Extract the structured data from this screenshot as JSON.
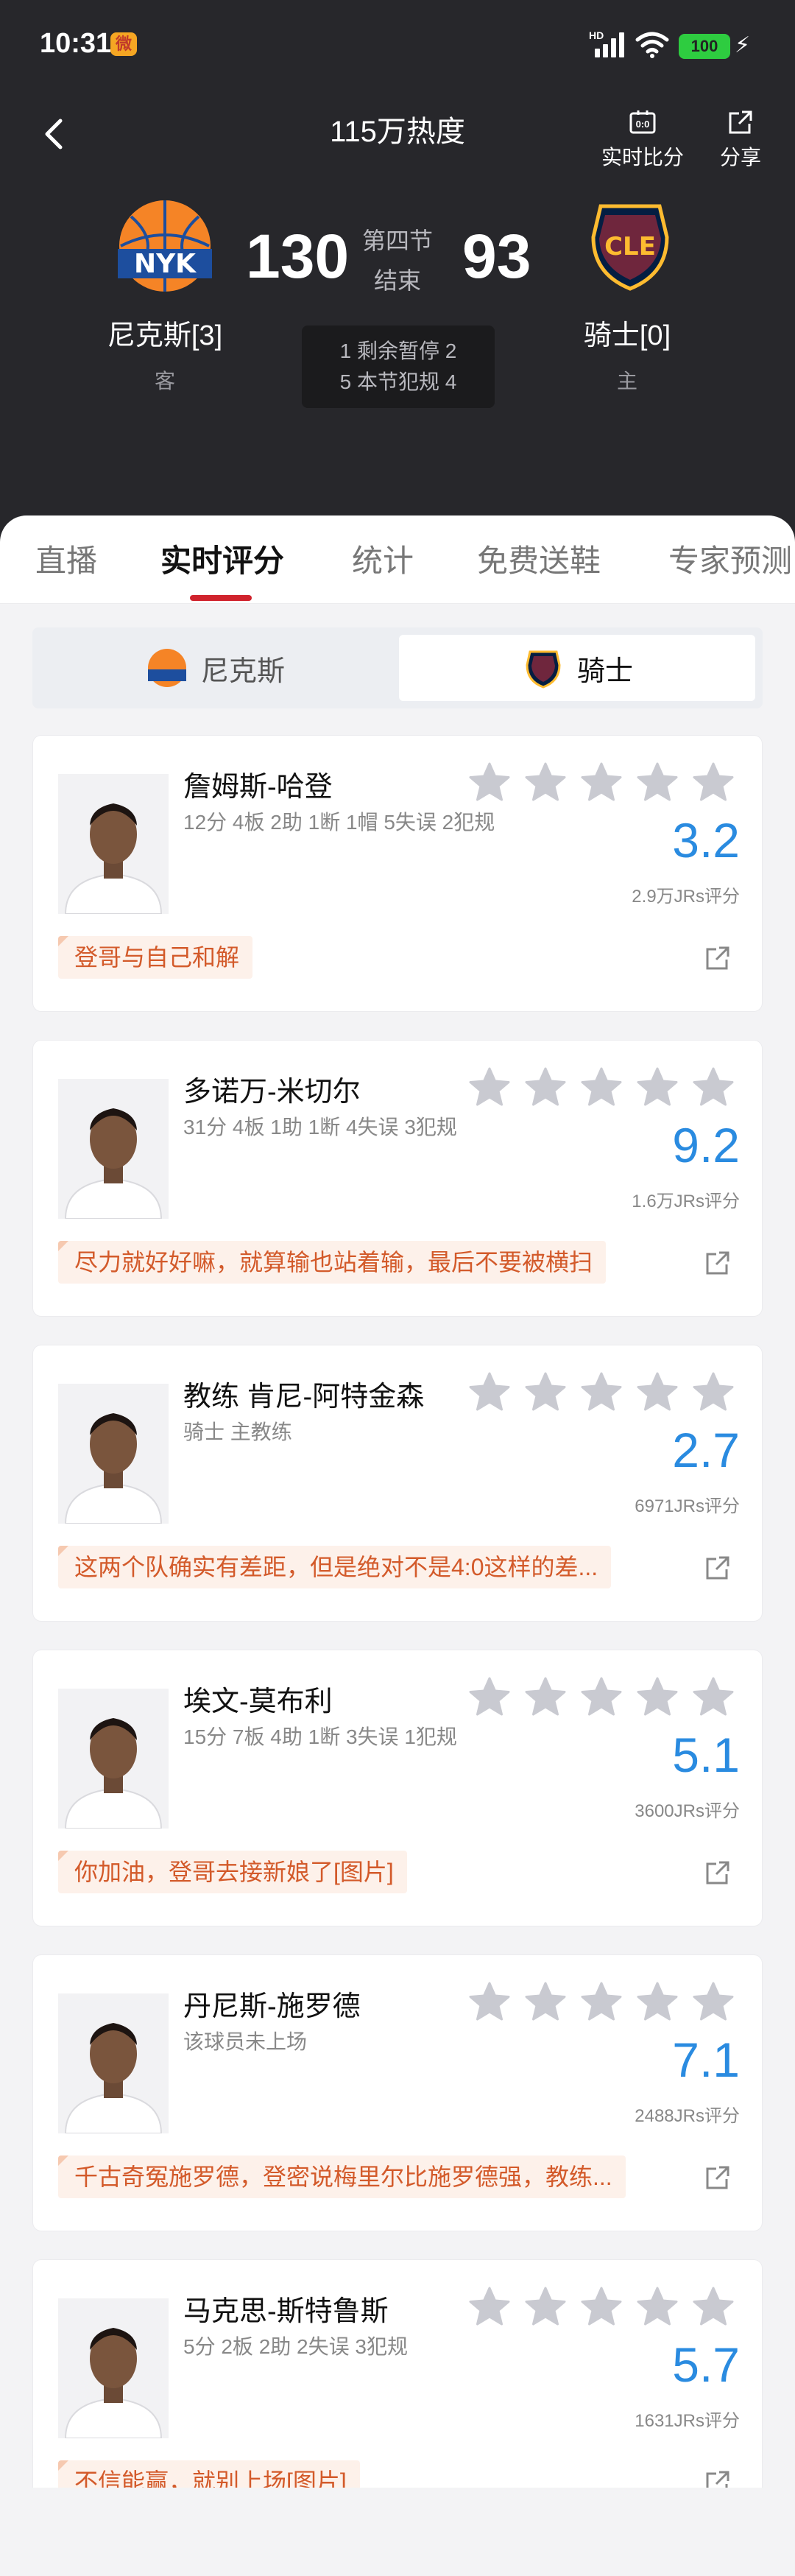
{
  "status_bar": {
    "time": "10:31",
    "battery": "100",
    "hd": "HD"
  },
  "nav": {
    "title": "115万热度",
    "live_score": "实时比分",
    "share": "分享"
  },
  "game": {
    "home": {
      "name": "尼克斯[3]",
      "role": "客",
      "score": "130",
      "logo_text": "NYK",
      "color": "#f58426"
    },
    "away": {
      "name": "骑士[0]",
      "role": "主",
      "score": "93",
      "logo_text": "CLE",
      "color": "#6f263d"
    },
    "period": "第四节",
    "status": "结束",
    "info_line1": "1 剩余暂停 2",
    "info_line2": "5 本节犯规 4"
  },
  "tabs": [
    {
      "label": "直播"
    },
    {
      "label": "实时评分"
    },
    {
      "label": "统计"
    },
    {
      "label": "免费送鞋"
    },
    {
      "label": "专家预测"
    }
  ],
  "team_switch": {
    "home": "尼克斯",
    "away": "骑士"
  },
  "players": [
    {
      "name": "詹姆斯-哈登",
      "stats": "12分 4板 2助 1断 1帽 5失误 2犯规",
      "rating": "3.2",
      "votes": "2.9万JRs评分",
      "comment": "登哥与自己和解"
    },
    {
      "name": "多诺万-米切尔",
      "stats": "31分 4板 1助 1断 4失误 3犯规",
      "rating": "9.2",
      "votes": "1.6万JRs评分",
      "comment": "尽力就好好嘛，就算输也站着输，最后不要被横扫"
    },
    {
      "name": "教练 肯尼-阿特金森",
      "stats": "骑士 主教练",
      "rating": "2.7",
      "votes": "6971JRs评分",
      "comment": "这两个队确实有差距，但是绝对不是4:0这样的差..."
    },
    {
      "name": "埃文-莫布利",
      "stats": "15分 7板 4助 1断 3失误 1犯规",
      "rating": "5.1",
      "votes": "3600JRs评分",
      "comment": "你加油，登哥去接新娘了[图片]"
    },
    {
      "name": "丹尼斯-施罗德",
      "stats": "该球员未上场",
      "rating": "7.1",
      "votes": "2488JRs评分",
      "comment": "千古奇冤施罗德，登密说梅里尔比施罗德强，教练..."
    },
    {
      "name": "马克思-斯特鲁斯",
      "stats": "5分 2板 2助 2失误 3犯规",
      "rating": "5.7",
      "votes": "1631JRs评分",
      "comment": "不信能赢，就别上场[图片]"
    }
  ],
  "colors": {
    "accent": "#d0232d",
    "rating": "#2a8be0",
    "comment_text": "#d35a2a",
    "header_bg": "#27272b"
  }
}
